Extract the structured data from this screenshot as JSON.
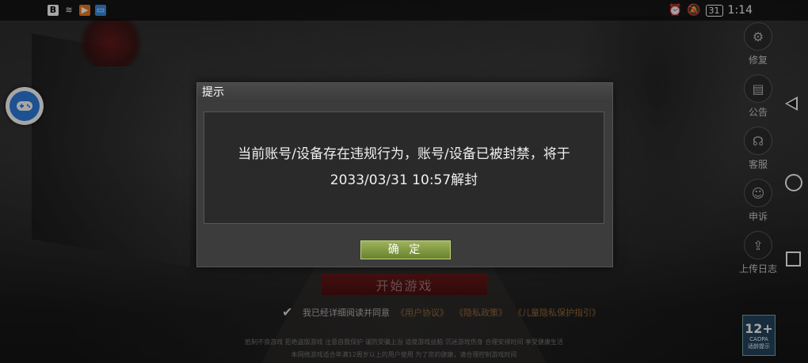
{
  "status_bar": {
    "time": "1:14",
    "battery": "31"
  },
  "side_menu": [
    {
      "label": "修复",
      "icon": "gear-icon"
    },
    {
      "label": "公告",
      "icon": "notice-icon"
    },
    {
      "label": "客服",
      "icon": "headset-icon"
    },
    {
      "label": "申诉",
      "icon": "appeal-icon"
    },
    {
      "label": "上传日志",
      "icon": "upload-icon"
    }
  ],
  "start_button": "开始游戏",
  "agreement": {
    "text": "我已经详细阅读并同意",
    "links": [
      "《用户协议》",
      "《隐私政策》",
      "《儿童隐私保护指引》"
    ]
  },
  "footer": {
    "line1": "抵制不良游戏 拒绝盗版游戏 注意自我保护 谨防受骗上当 适度游戏益脑 沉迷游戏伤身 合理安排时间 享受健康生活",
    "line2": "本网络游戏适合年满12周岁以上的用户使用  为了您的健康，请合理控制游戏时间"
  },
  "age_rating": {
    "big": "12+",
    "small": "CADPA",
    "sub": "适龄提示"
  },
  "dialog": {
    "title": "提示",
    "message": "当前账号/设备存在违规行为，账号/设备已被封禁，将于2033/03/31 10:57解封",
    "confirm": "确 定"
  }
}
